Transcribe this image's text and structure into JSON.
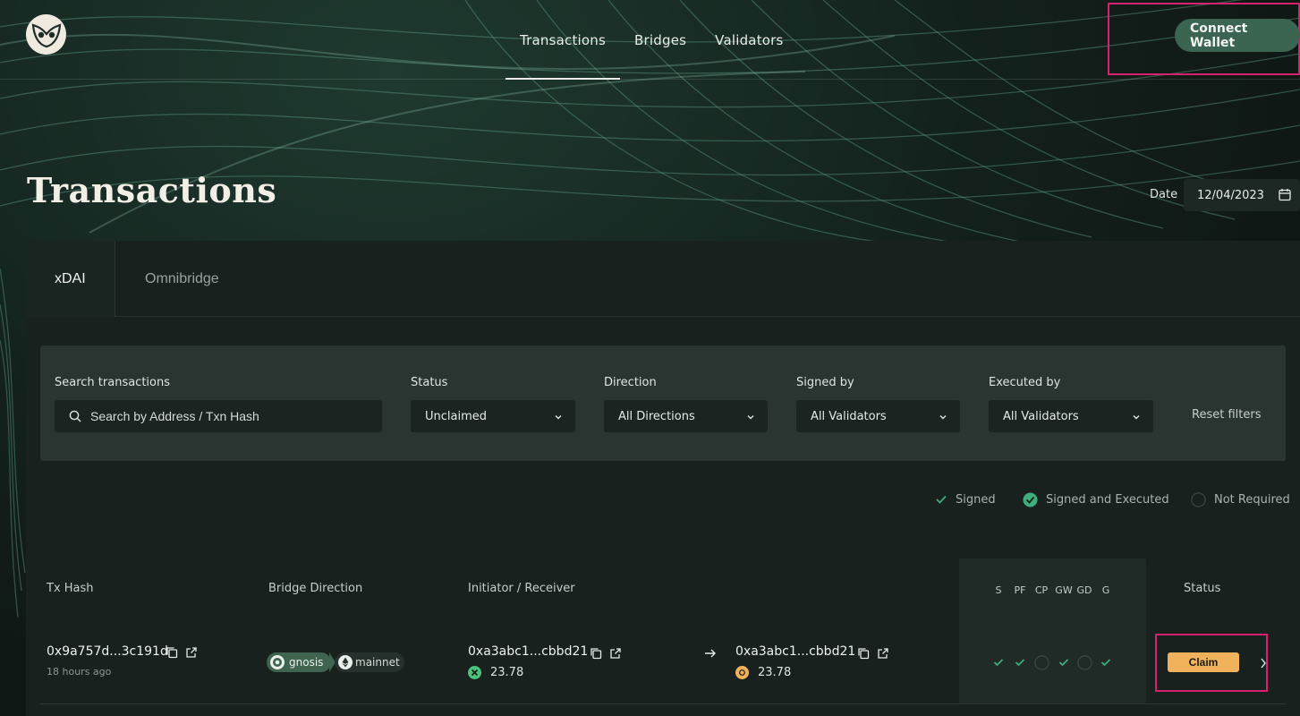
{
  "header": {
    "nav": [
      "Transactions",
      "Bridges",
      "Validators"
    ],
    "active_nav": "Transactions",
    "connect_label": "Connect Wallet"
  },
  "page": {
    "title": "Transactions",
    "date_label": "Date",
    "date_value": "12/04/2023"
  },
  "tabs": [
    {
      "label": "xDAI",
      "active": true
    },
    {
      "label": "Omnibridge",
      "active": false
    }
  ],
  "filters": {
    "search_label": "Search transactions",
    "search_placeholder": "Search by Address / Txn Hash",
    "status_label": "Status",
    "status_value": "Unclaimed",
    "direction_label": "Direction",
    "direction_value": "All Directions",
    "signed_label": "Signed by",
    "signed_value": "All Validators",
    "executed_label": "Executed by",
    "executed_value": "All Validators",
    "reset_label": "Reset filters"
  },
  "legend": {
    "signed": "Signed",
    "signed_executed": "Signed and Executed",
    "not_required": "Not Required"
  },
  "table": {
    "headers": {
      "tx_hash": "Tx Hash",
      "bridge_direction": "Bridge Direction",
      "initiator_receiver": "Initiator / Receiver",
      "status": "Status"
    },
    "validator_headers": [
      "S",
      "PF",
      "CP",
      "GW",
      "GD",
      "G"
    ],
    "rows": [
      {
        "tx_hash": "0x9a757d...3c191d",
        "time": "18 hours ago",
        "from_chain": "gnosis",
        "to_chain": "mainnet",
        "initiator": "0xa3abc1...cbbd21",
        "initiator_amount": "23.78",
        "receiver": "0xa3abc1...cbbd21",
        "receiver_amount": "23.78",
        "validators": [
          "signed",
          "signed",
          "not-required",
          "signed",
          "not-required",
          "signed"
        ],
        "action": "Claim"
      }
    ]
  },
  "colors": {
    "accent_green": "#3b6451",
    "check_green": "#3fae7e",
    "claim_orange": "#f0b35c",
    "highlight": "#d6226c"
  }
}
